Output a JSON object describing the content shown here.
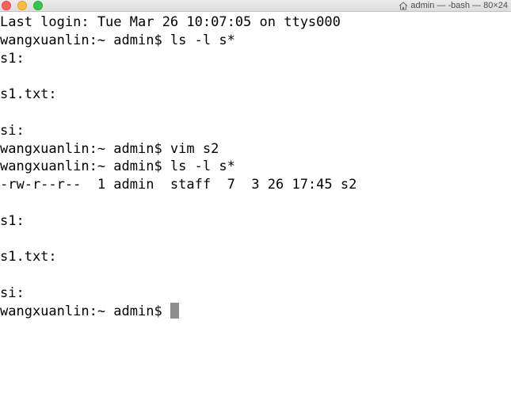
{
  "window": {
    "title": "admin — -bash — 80×24",
    "title_icon": "home-icon",
    "controls": [
      "close",
      "minimize",
      "zoom"
    ],
    "colors": {
      "close": "#fc605c",
      "minimize": "#fdbc40",
      "zoom": "#34c84a"
    }
  },
  "terminal": {
    "lines": [
      "Last login: Tue Mar 26 10:07:05 on ttys000",
      "wangxuanlin:~ admin$ ls -l s*",
      "s1:",
      "",
      "s1.txt:",
      "",
      "si:",
      "wangxuanlin:~ admin$ vim s2",
      "wangxuanlin:~ admin$ ls -l s*",
      "-rw-r--r--  1 admin  staff  7  3 26 17:45 s2",
      "",
      "s1:",
      "",
      "s1.txt:",
      "",
      "si:"
    ],
    "prompt": "wangxuanlin:~ admin$ "
  }
}
